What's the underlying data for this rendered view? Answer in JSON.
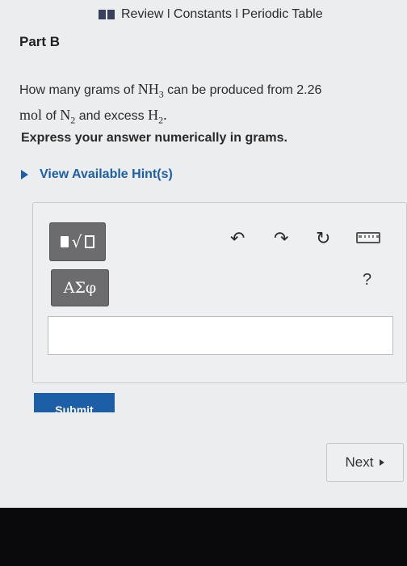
{
  "header": {
    "icon": "book-icon",
    "links": [
      "Review",
      "Constants",
      "Periodic Table"
    ],
    "separator": "I"
  },
  "part": {
    "title": "Part B"
  },
  "question": {
    "text_1": "How many grams of",
    "formula_1": "NH",
    "formula_1_sub": "3",
    "text_2": "can be produced from 2.26",
    "unit": "mol",
    "text_3": "of",
    "formula_2": "N",
    "formula_2_sub": "2",
    "text_4": "and excess",
    "formula_3": "H",
    "formula_3_sub": "2",
    "text_5": "."
  },
  "instruction": "Express your answer numerically in grams.",
  "hint": {
    "label": "View Available Hint(s)"
  },
  "toolbar": {
    "greek_label": "ΑΣφ",
    "help_label": "?",
    "undo_icon": "↶",
    "redo_icon": "↷",
    "reset_icon": "↻"
  },
  "answer": {
    "value": ""
  },
  "submit": {
    "label": "Submit"
  },
  "next": {
    "label": "Next"
  },
  "colors": {
    "link": "#1d5fa6",
    "button": "#1d5fa6",
    "tool": "#6c6c6e"
  }
}
